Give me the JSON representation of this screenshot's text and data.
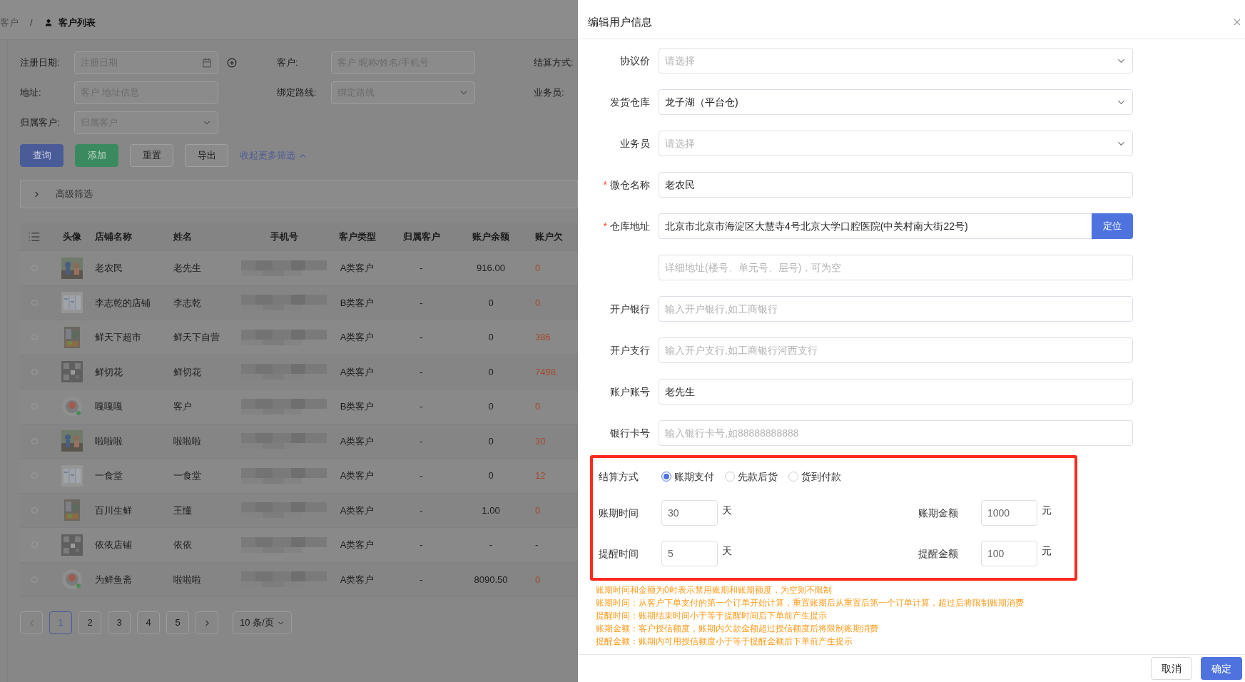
{
  "breadcrumb": {
    "items": [
      "客户",
      "客户列表"
    ],
    "separator": "/"
  },
  "filters": [
    {
      "label": "注册日期:",
      "kind": "date",
      "placeholder": "注册日期"
    },
    {
      "label": "客户:",
      "kind": "text",
      "placeholder": "客户 昵称/姓名/手机号"
    },
    {
      "label": "结算方式:",
      "kind": "label_only"
    },
    {
      "label": "地址:",
      "kind": "text",
      "placeholder": "客户 地址信息"
    },
    {
      "label": "绑定路线:",
      "kind": "select",
      "placeholder": "绑定路线"
    },
    {
      "label": "业务员:",
      "kind": "label_only"
    },
    {
      "label": "归属客户:",
      "kind": "select",
      "placeholder": "归属客户"
    }
  ],
  "actions": [
    {
      "label": "查询",
      "kind": "primary"
    },
    {
      "label": "添加",
      "kind": "success"
    },
    {
      "label": "重置",
      "kind": "default"
    },
    {
      "label": "导出",
      "kind": "default"
    }
  ],
  "collapse_link": "收起更多筛选",
  "advanced_filter": {
    "label": "高级筛选",
    "expanded": false
  },
  "table": {
    "columns": [
      "头像",
      "店铺名称",
      "姓名",
      "手机号",
      "客户类型",
      "归属客户",
      "账户余额",
      "账户欠"
    ],
    "rows": [
      {
        "selected": false,
        "store": "老农民",
        "name": "老先生",
        "type": "A类客户",
        "owner": "-",
        "balance": "916.00",
        "debt": "0",
        "color": "#a4492f"
      },
      {
        "selected": false,
        "store": "李志乾的店铺",
        "name": "李志乾",
        "type": "B类客户",
        "owner": "-",
        "balance": "0",
        "debt": "0",
        "color": "#a4492f"
      },
      {
        "selected": false,
        "store": "鲜天下超市",
        "name": "鲜天下自营",
        "type": "A类客户",
        "owner": "-",
        "balance": "0",
        "debt": "386",
        "color": "#a4492f"
      },
      {
        "selected": false,
        "store": "鲜切花",
        "name": "鲜切花",
        "type": "A类客户",
        "owner": "-",
        "balance": "0",
        "debt": "7498.",
        "color": "#a4492f"
      },
      {
        "selected": false,
        "store": "嘎嘎嘎",
        "name": "客户",
        "type": "B类客户",
        "owner": "-",
        "balance": "0",
        "debt": "0",
        "color": "#a4492f"
      },
      {
        "selected": false,
        "store": "啦啦啦",
        "name": "啦啦啦",
        "type": "A类客户",
        "owner": "-",
        "balance": "0",
        "debt": "30",
        "color": "#a4492f"
      },
      {
        "selected": false,
        "store": "一食堂",
        "name": "一食堂",
        "type": "A类客户",
        "owner": "-",
        "balance": "0",
        "debt": "12",
        "color": "#a4492f"
      },
      {
        "selected": false,
        "store": "百川生鲜",
        "name": "王懂",
        "type": "A类客户",
        "owner": "-",
        "balance": "1.00",
        "debt": "0",
        "color": "#a4492f"
      },
      {
        "selected": false,
        "store": "依依店铺",
        "name": "依依",
        "type": "A类客户",
        "owner": "-",
        "balance": "-",
        "debt": "-"
      },
      {
        "selected": false,
        "store": "为鲜鱼斋",
        "name": "啦啦啦",
        "type": "A类客户",
        "owner": "-",
        "balance": "8090.50",
        "debt": "0",
        "color": "#a4492f"
      }
    ]
  },
  "pagination": {
    "pages": [
      {
        "label": "1",
        "selected": true
      },
      {
        "label": "2",
        "selected": false
      },
      {
        "label": "3",
        "selected": false
      },
      {
        "label": "4",
        "selected": false
      },
      {
        "label": "5",
        "selected": false
      }
    ],
    "page_size": "10 条/页"
  },
  "drawer": {
    "title": "编辑用户信息",
    "required_mark": "*",
    "fields": [
      {
        "label": "协议价",
        "kind": "select",
        "required": false,
        "placeholder": "请选择"
      },
      {
        "label": "发货仓库",
        "kind": "select",
        "required": false,
        "value": "龙子湖（平台仓)"
      },
      {
        "label": "业务员",
        "kind": "select",
        "required": false,
        "placeholder": "请选择"
      },
      {
        "label": "微仓名称",
        "kind": "text",
        "required": true,
        "value": "老农民"
      },
      {
        "label": "仓库地址",
        "kind": "address",
        "required": true,
        "value": "北京市北京市海淀区大慧寺4号北京大学口腔医院(中关村南大街22号)",
        "button": "定位"
      },
      {
        "kind": "text",
        "required": false,
        "placeholder": "详细地址(楼号、单元号、层号)，可为空"
      },
      {
        "label": "开户银行",
        "kind": "text",
        "required": false,
        "placeholder": "输入开户银行,如工商银行"
      },
      {
        "label": "开户支行",
        "kind": "text",
        "required": false,
        "placeholder": "输入开户支行,如工商银行河西支行"
      },
      {
        "label": "账户账号",
        "kind": "text",
        "required": false,
        "value": "老先生"
      },
      {
        "label": "银行卡号",
        "kind": "text",
        "required": false,
        "placeholder": "输入银行卡号,如88888888888"
      }
    ],
    "settlement": {
      "label": "结算方式",
      "highlighted": true,
      "options": [
        {
          "label": "账期支付",
          "selected": true
        },
        {
          "label": "先款后货",
          "selected": false
        },
        {
          "label": "货到付款",
          "selected": false
        }
      ],
      "terms": [
        {
          "label": "账期时间",
          "value": "30",
          "unit": "天"
        },
        {
          "label": "账期金额",
          "value": "1000",
          "unit": "元"
        },
        {
          "label": "提醒时间",
          "value": "5",
          "unit": "天"
        },
        {
          "label": "提醒金额",
          "value": "100",
          "unit": "元"
        }
      ]
    },
    "notes": [
      "账期时间和金额为0时表示禁用账期和账期额度，为空则不限制",
      "账期时间：从客户下单支付的第一个订单开始计算，重置账期后从重置后第一个订单计算，超过后将限制账期消费",
      "提醒时间：账期结束时间小于等于提醒时间后下单前产生提示",
      "账期金额：客户授信额度，账期内欠款金额超过授信额度后将限制账期消费",
      "提醒金额：账期内可用授信额度小于等于提醒金额后下单前产生提示"
    ],
    "buttons": [
      {
        "label": "取消",
        "kind": "default"
      },
      {
        "label": "确定",
        "kind": "primary"
      }
    ]
  }
}
